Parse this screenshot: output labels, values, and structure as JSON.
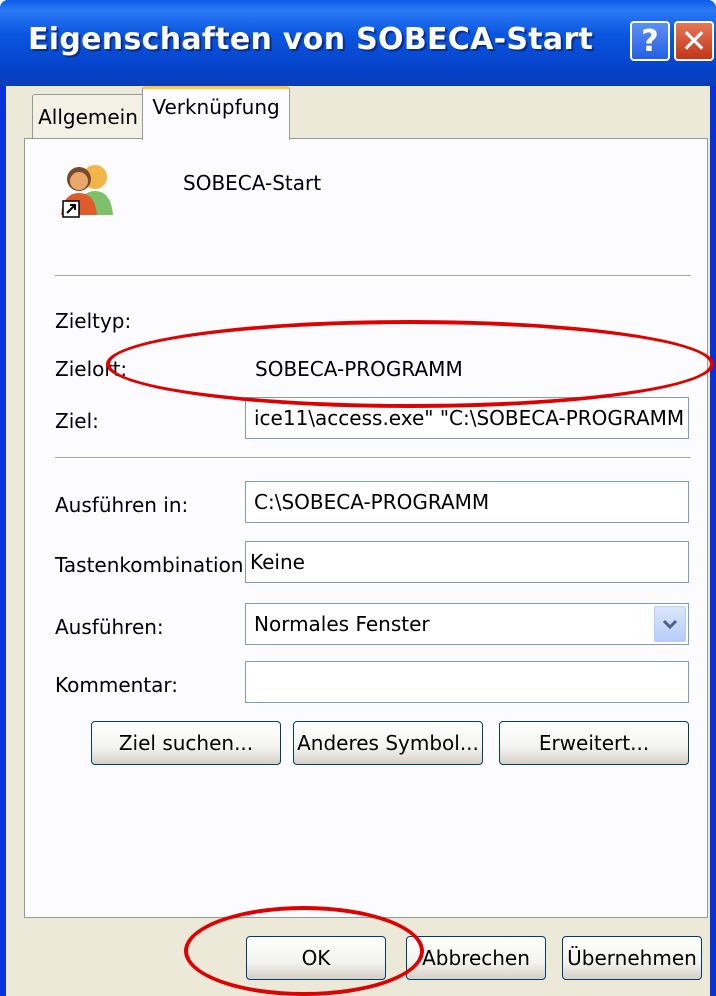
{
  "window": {
    "title": "Eigenschaften von SOBECA-Start",
    "help_glyph": "?",
    "close_glyph": "✕"
  },
  "tabs": [
    {
      "label": "Allgemein",
      "active": false
    },
    {
      "label": "Verknüpfung",
      "active": true
    }
  ],
  "shortcut": {
    "name": "SOBECA-Start",
    "icon": "users-shortcut-icon"
  },
  "fields": {
    "target_type": {
      "label": "Zieltyp:",
      "value": ""
    },
    "target_location": {
      "label": "Zielort:",
      "value": "SOBECA-PROGRAMM"
    },
    "target": {
      "label": "Ziel:",
      "value": "ice11\\access.exe\" \"C:\\SOBECA-PROGRAMM"
    },
    "start_in": {
      "label": "Ausführen in:",
      "value": "C:\\SOBECA-PROGRAMM"
    },
    "shortcut_key": {
      "label": "Tastenkombination:",
      "value": "Keine"
    },
    "run": {
      "label": "Ausführen:",
      "value": "Normales Fenster"
    },
    "comment": {
      "label": "Kommentar:",
      "value": ""
    }
  },
  "buttons": {
    "find_target": "Ziel suchen...",
    "change_icon": "Anderes Symbol...",
    "advanced": "Erweitert...",
    "ok": "OK",
    "cancel": "Abbrechen",
    "apply": "Übernehmen"
  },
  "colors": {
    "annotation": "#e00000",
    "titlebar": "#0a56e0",
    "dialog_bg": "#ece9d8"
  }
}
